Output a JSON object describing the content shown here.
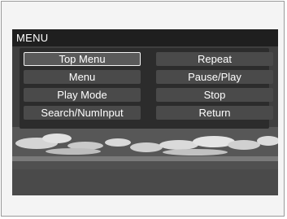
{
  "menu": {
    "title": "MENU",
    "items_left": [
      {
        "label": "Top Menu",
        "selected": true
      },
      {
        "label": "Menu",
        "selected": false
      },
      {
        "label": "Play Mode",
        "selected": false
      },
      {
        "label": "Search/NumInput",
        "selected": false
      }
    ],
    "items_right": [
      {
        "label": "Repeat",
        "selected": false
      },
      {
        "label": "Pause/Play",
        "selected": false
      },
      {
        "label": "Stop",
        "selected": false
      },
      {
        "label": "Return",
        "selected": false
      }
    ]
  },
  "colors": {
    "title_bar": "#1f1f1f",
    "panel": "#2c2c2c",
    "button": "#4a4a4a",
    "selected_border": "#f2f2f2",
    "text": "#ffffff"
  }
}
